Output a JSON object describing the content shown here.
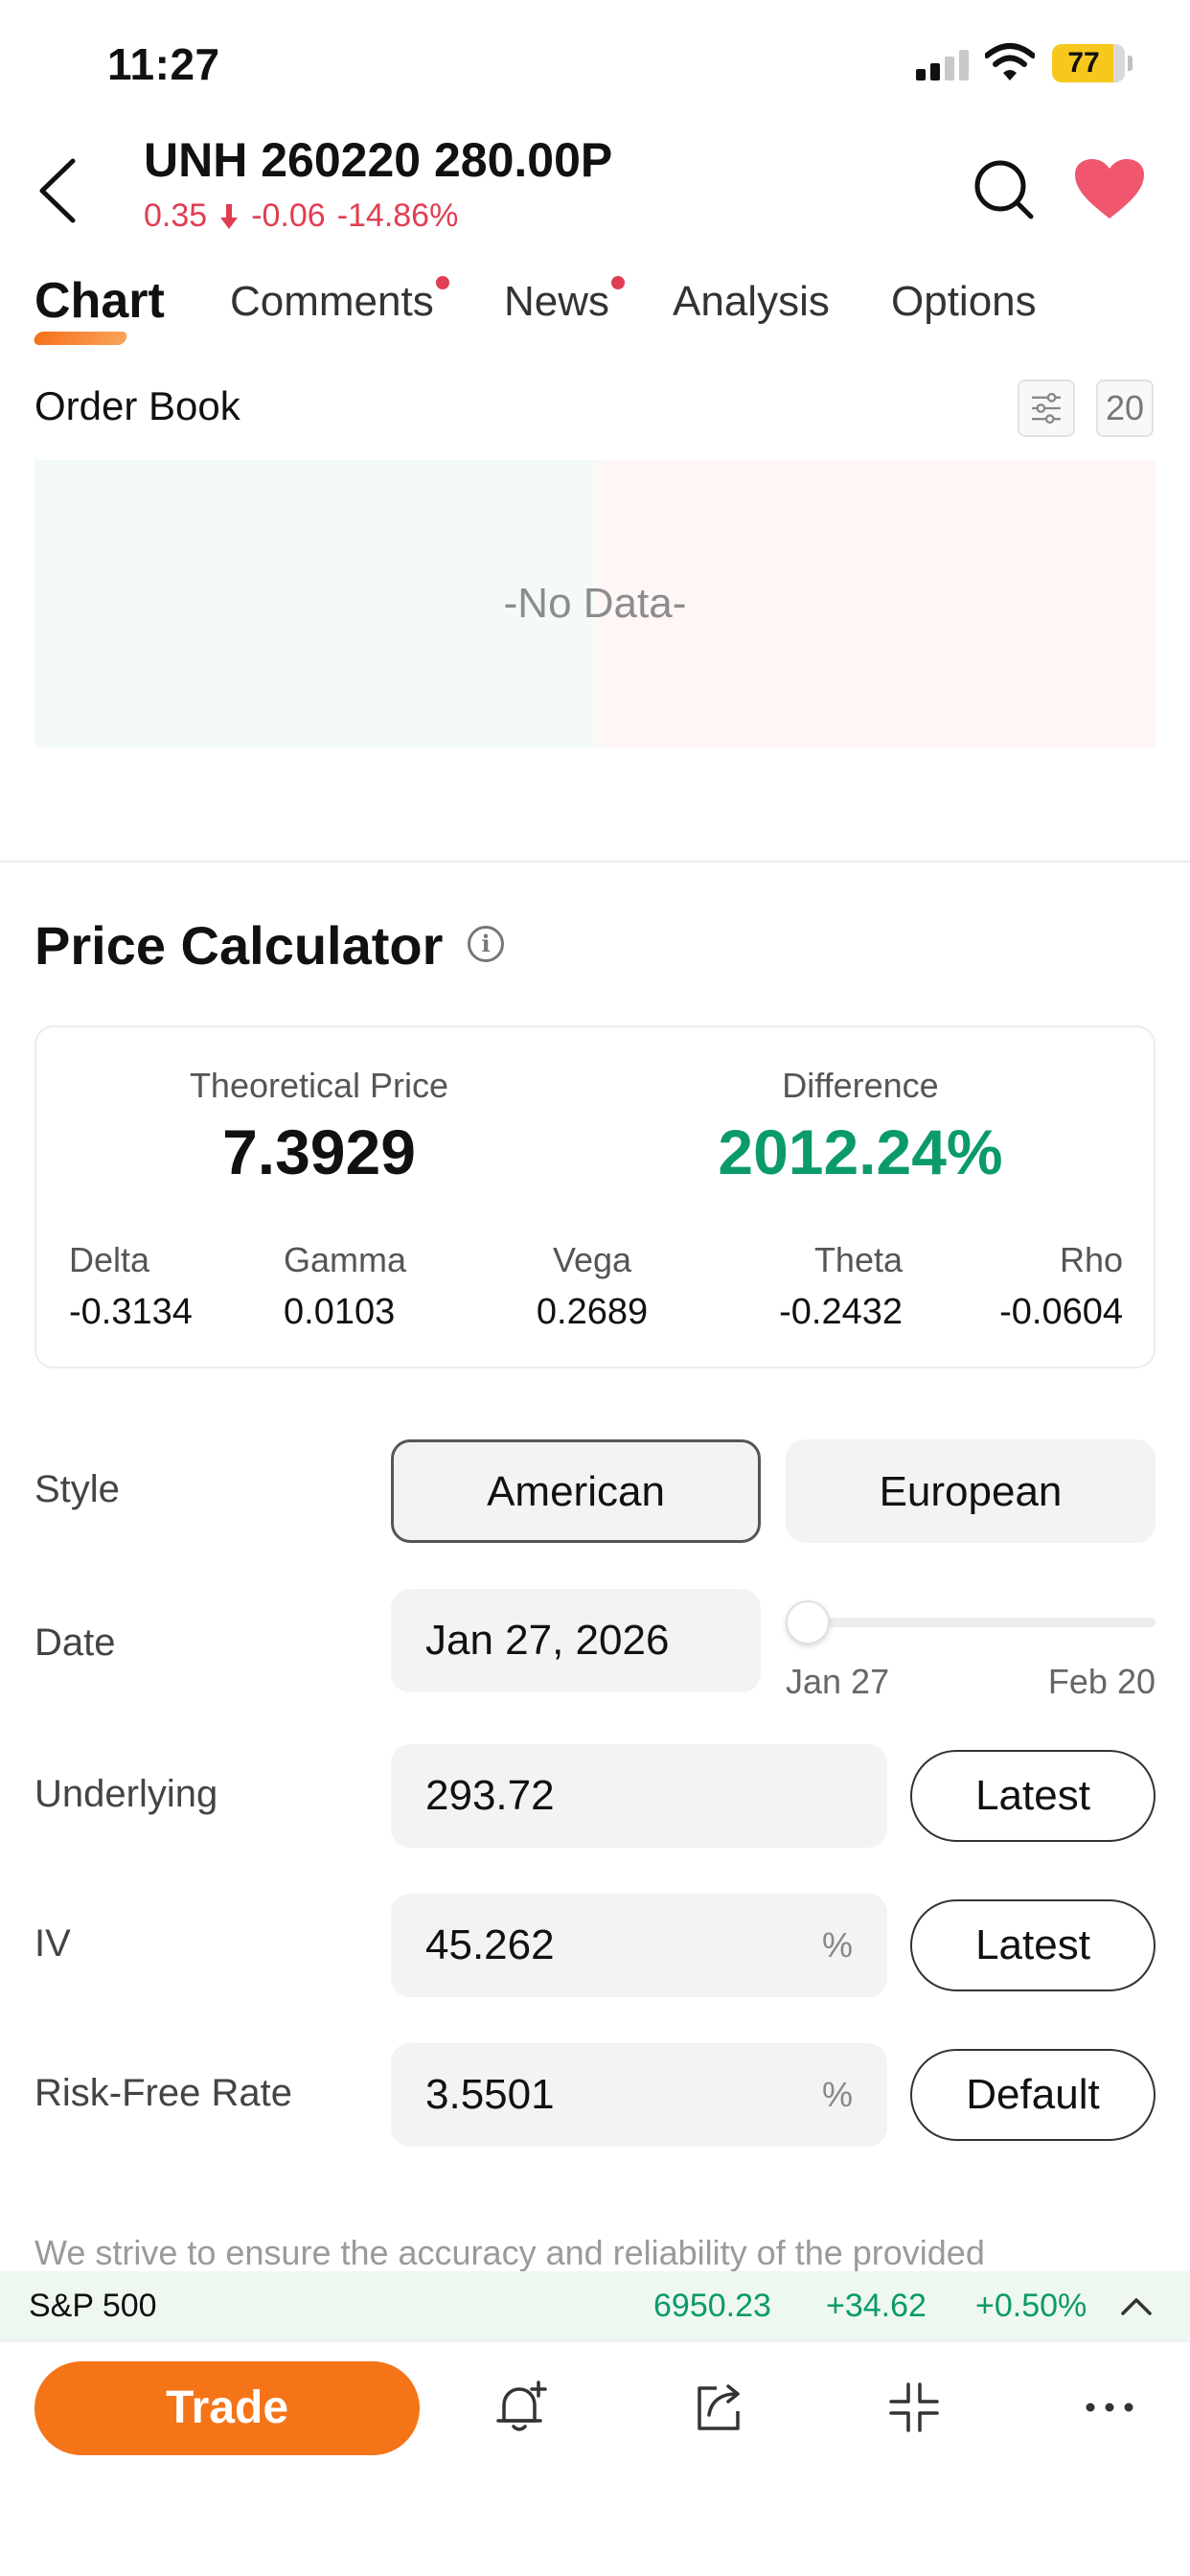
{
  "status_bar": {
    "time": "11:27",
    "battery": "77",
    "icons": [
      "cellular-signal-icon",
      "wifi-icon",
      "battery-icon"
    ]
  },
  "header": {
    "title": "UNH 260220 280.00P",
    "price": "0.35",
    "change": "-0.06",
    "change_pct": "-14.86%",
    "down_color": "#e03e52",
    "icons": [
      "back-arrow-icon",
      "search-icon",
      "heart-icon"
    ]
  },
  "tabs": [
    {
      "label": "Chart",
      "active": true
    },
    {
      "label": "Comments",
      "badge": true
    },
    {
      "label": "News",
      "badge": true
    },
    {
      "label": "Analysis"
    },
    {
      "label": "Options"
    }
  ],
  "order_book": {
    "title": "Order Book",
    "depth": "20",
    "empty_text": "-No Data-",
    "icons": [
      "filter-sliders-icon"
    ]
  },
  "price_calculator": {
    "title": "Price Calculator",
    "info_icon": "i",
    "theoretical_price_label": "Theoretical Price",
    "theoretical_price": "7.3929",
    "difference_label": "Difference",
    "difference": "2012.24%",
    "positive_color": "#0b9a6a",
    "greeks": [
      {
        "label": "Delta",
        "value": "-0.3134"
      },
      {
        "label": "Gamma",
        "value": "0.0103"
      },
      {
        "label": "Vega",
        "value": "0.2689"
      },
      {
        "label": "Theta",
        "value": "-0.2432"
      },
      {
        "label": "Rho",
        "value": "-0.0604"
      }
    ],
    "style": {
      "label": "Style",
      "options": [
        "American",
        "European"
      ],
      "selected": "American"
    },
    "date": {
      "label": "Date",
      "value": "Jan 27, 2026",
      "slider_min": "Jan 27",
      "slider_max": "Feb 20",
      "slider_position": 0
    },
    "underlying": {
      "label": "Underlying",
      "value": "293.72",
      "button": "Latest"
    },
    "iv": {
      "label": "IV",
      "value": "45.262",
      "unit": "%",
      "button": "Latest"
    },
    "risk_free_rate": {
      "label": "Risk-Free Rate",
      "value": "3.5501",
      "unit": "%",
      "button": "Default"
    },
    "disclaimer": "We strive to ensure the accuracy and reliability of the provided"
  },
  "index_ticker": {
    "name": "S&P 500",
    "value": "6950.23",
    "change": "+34.62",
    "change_pct": "+0.50%",
    "icons": [
      "chevron-up-icon"
    ]
  },
  "bottom_bar": {
    "trade_label": "Trade",
    "accent_color": "#f57418",
    "icons": [
      "alert-bell-icon",
      "share-icon",
      "collapse-icon",
      "more-icon"
    ]
  }
}
